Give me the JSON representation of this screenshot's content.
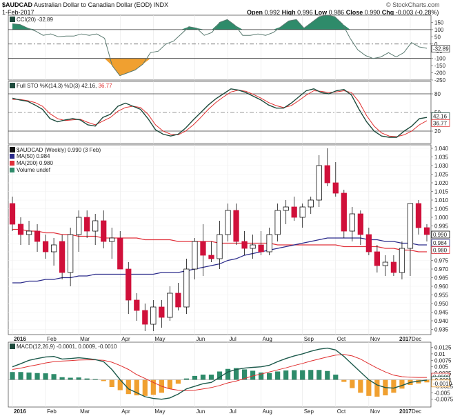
{
  "header": {
    "symbol": "$AUDCAD",
    "description": "Australian Dollar to Canadian Dollar (EOD)",
    "exchange": "INDX",
    "date": "1-Feb-2017",
    "open_label": "Open",
    "open": "0.992",
    "high_label": "High",
    "high": "0.996",
    "low_label": "Low",
    "low": "0.986",
    "close_label": "Close",
    "close": "0.990",
    "chg_label": "Chg",
    "chg": "-0.003 (-0.28%)",
    "watermark": "© StockCharts.com"
  },
  "months": [
    "2016",
    "Feb",
    "Mar",
    "Apr",
    "May",
    "Jun",
    "Jul",
    "Aug",
    "Sep",
    "Oct",
    "Nov",
    "Dec",
    "2017"
  ],
  "colors": {
    "up": "#ffffff",
    "down": "#d0103a",
    "ma50": "#2a2a8a",
    "ma200": "#e0303a",
    "cci_pos": "#2e8b6a",
    "cci_neg": "#f0a030",
    "sto_k": "#1d4a3c",
    "sto_d": "#e03030",
    "macd_line": "#1d5a4c",
    "signal_line": "#e03030",
    "hist_pos": "#2e8b6a",
    "hist_neg": "#f0a030"
  },
  "chart_data": [
    {
      "type": "line",
      "title": "CCI(20) -32.89",
      "series": [
        {
          "name": "CCI(20)",
          "values": [
            140,
            135,
            110,
            90,
            60,
            70,
            50,
            55,
            55,
            70,
            60,
            70,
            40,
            -150,
            -220,
            -200,
            -180,
            -140,
            -60,
            -50,
            0,
            20,
            70,
            120,
            110,
            60,
            80,
            150,
            170,
            130,
            60,
            60,
            70,
            60,
            80,
            120,
            160,
            170,
            110,
            150,
            190,
            200,
            190,
            140,
            40,
            -40,
            -80,
            -100,
            -90,
            -60,
            -90,
            -60,
            10,
            -20,
            -30
          ]
        }
      ],
      "ylim": [
        -250,
        200
      ],
      "yticks": [
        -250,
        -200,
        -150,
        -100,
        -50,
        0,
        50,
        100,
        150
      ],
      "current_label": "-32.89"
    },
    {
      "type": "line",
      "title": "Full STO %K(14,3) %D(3) 42.16, 36.77",
      "series": [
        {
          "name": "%K(14,3)",
          "values": [
            73,
            70,
            68,
            62,
            55,
            40,
            35,
            38,
            40,
            38,
            30,
            28,
            42,
            47,
            60,
            65,
            60,
            55,
            40,
            22,
            15,
            12,
            15,
            25,
            38,
            50,
            62,
            72,
            80,
            88,
            86,
            82,
            76,
            70,
            62,
            57,
            57,
            65,
            75,
            85,
            88,
            82,
            80,
            85,
            87,
            78,
            55,
            35,
            20,
            12,
            10,
            10,
            20,
            28,
            40,
            42
          ]
        },
        {
          "name": "%D(3)",
          "values": [
            71,
            71,
            69,
            66,
            60,
            48,
            40,
            37,
            38,
            39,
            34,
            30,
            36,
            42,
            52,
            58,
            60,
            58,
            47,
            30,
            20,
            15,
            14,
            20,
            30,
            42,
            55,
            66,
            75,
            83,
            86,
            84,
            79,
            73,
            66,
            61,
            58,
            61,
            69,
            78,
            85,
            84,
            82,
            83,
            85,
            82,
            67,
            45,
            28,
            17,
            12,
            11,
            14,
            20,
            30,
            36.77
          ]
        }
      ],
      "ylim": [
        0,
        100
      ],
      "yticks": [
        20,
        50,
        80
      ],
      "current_labels": [
        "42.16",
        "36.77"
      ]
    },
    {
      "type": "candlestick",
      "title": "$AUDCAD (Weekly) 0.990 (3 Feb)",
      "legend": [
        {
          "label": "MA(50) 0.984"
        },
        {
          "label": "MA(200) 0.980"
        },
        {
          "label": "Volume undef"
        }
      ],
      "x": [
        "2016",
        "Feb",
        "Mar",
        "Apr",
        "May",
        "Jun",
        "Jul",
        "Aug",
        "Sep",
        "Oct",
        "Nov",
        "Dec",
        "2017"
      ],
      "ohlc": [
        [
          1.008,
          1.012,
          0.992,
          0.996
        ],
        [
          0.996,
          1.0,
          0.984,
          0.99
        ],
        [
          0.99,
          0.998,
          0.984,
          0.992
        ],
        [
          0.992,
          0.996,
          0.98,
          0.986
        ],
        [
          0.986,
          0.99,
          0.976,
          0.98
        ],
        [
          0.98,
          0.988,
          0.972,
          0.984
        ],
        [
          0.986,
          0.99,
          0.964,
          0.968
        ],
        [
          0.968,
          0.994,
          0.96,
          0.99
        ],
        [
          0.99,
          1.004,
          0.98,
          1.0
        ],
        [
          1.0,
          1.004,
          0.988,
          0.992
        ],
        [
          0.992,
          1.002,
          0.984,
          0.998
        ],
        [
          0.998,
          1.004,
          0.982,
          0.986
        ],
        [
          0.986,
          0.994,
          0.976,
          0.988
        ],
        [
          0.988,
          0.992,
          0.97,
          0.97
        ],
        [
          0.97,
          0.974,
          0.944,
          0.952
        ],
        [
          0.952,
          0.956,
          0.94,
          0.946
        ],
        [
          0.946,
          0.95,
          0.934,
          0.938
        ],
        [
          0.938,
          0.952,
          0.934,
          0.948
        ],
        [
          0.948,
          0.952,
          0.936,
          0.942
        ],
        [
          0.942,
          0.96,
          0.94,
          0.956
        ],
        [
          0.956,
          0.962,
          0.946,
          0.948
        ],
        [
          0.948,
          0.976,
          0.944,
          0.97
        ],
        [
          0.97,
          0.988,
          0.964,
          0.986
        ],
        [
          0.986,
          0.996,
          0.966,
          0.978
        ],
        [
          0.978,
          0.986,
          0.974,
          0.976
        ],
        [
          0.976,
          0.998,
          0.97,
          0.99
        ],
        [
          0.99,
          1.008,
          0.986,
          1.004
        ],
        [
          1.004,
          1.008,
          0.984,
          0.986
        ],
        [
          0.986,
          0.992,
          0.978,
          0.982
        ],
        [
          0.982,
          0.99,
          0.976,
          0.984
        ],
        [
          0.984,
          0.992,
          0.978,
          0.98
        ],
        [
          0.98,
          0.994,
          0.978,
          0.99
        ],
        [
          0.99,
          1.008,
          0.986,
          1.004
        ],
        [
          1.004,
          1.01,
          0.996,
          1.006
        ],
        [
          1.006,
          1.012,
          0.998,
          1.0
        ],
        [
          1.0,
          1.008,
          0.994,
          1.006
        ],
        [
          1.006,
          1.012,
          1.002,
          1.01
        ],
        [
          1.01,
          1.036,
          1.006,
          1.03
        ],
        [
          1.03,
          1.04,
          1.018,
          1.02
        ],
        [
          1.02,
          1.032,
          1.012,
          1.014
        ],
        [
          1.014,
          1.016,
          0.988,
          0.992
        ],
        [
          0.992,
          1.006,
          0.986,
          1.002
        ],
        [
          1.002,
          1.004,
          0.984,
          0.99
        ],
        [
          0.99,
          0.994,
          0.978,
          0.98
        ],
        [
          0.98,
          0.984,
          0.968,
          0.972
        ],
        [
          0.972,
          0.978,
          0.966,
          0.974
        ],
        [
          0.974,
          0.978,
          0.966,
          0.968
        ],
        [
          0.968,
          0.986,
          0.964,
          0.982
        ],
        [
          0.982,
          1.008,
          0.966,
          1.008
        ],
        [
          1.008,
          1.01,
          0.99,
          0.994
        ],
        [
          0.994,
          0.996,
          0.986,
          0.99
        ]
      ],
      "ma50": [
        0.962,
        0.962,
        0.963,
        0.963,
        0.964,
        0.964,
        0.965,
        0.965,
        0.966,
        0.966,
        0.967,
        0.967,
        0.967,
        0.967,
        0.967,
        0.967,
        0.967,
        0.967,
        0.968,
        0.968,
        0.968,
        0.969,
        0.97,
        0.971,
        0.972,
        0.973,
        0.975,
        0.976,
        0.978,
        0.979,
        0.98,
        0.981,
        0.982,
        0.983,
        0.984,
        0.985,
        0.986,
        0.987,
        0.988,
        0.988,
        0.988,
        0.988,
        0.988,
        0.987,
        0.987,
        0.986,
        0.986,
        0.985,
        0.985,
        0.984,
        0.984
      ],
      "ma200": [
        0.993,
        0.993,
        0.992,
        0.992,
        0.991,
        0.991,
        0.99,
        0.99,
        0.989,
        0.989,
        0.989,
        0.988,
        0.988,
        0.988,
        0.988,
        0.988,
        0.987,
        0.987,
        0.987,
        0.987,
        0.986,
        0.986,
        0.986,
        0.986,
        0.986,
        0.985,
        0.985,
        0.985,
        0.985,
        0.985,
        0.985,
        0.985,
        0.984,
        0.984,
        0.984,
        0.984,
        0.984,
        0.984,
        0.984,
        0.984,
        0.983,
        0.983,
        0.983,
        0.983,
        0.983,
        0.982,
        0.982,
        0.981,
        0.981,
        0.98,
        0.98
      ],
      "ylim": [
        0.932,
        1.042
      ],
      "yticks": [
        0.935,
        0.94,
        0.945,
        0.95,
        0.955,
        0.96,
        0.965,
        0.97,
        0.975,
        0.98,
        0.985,
        0.99,
        0.995,
        1.0,
        1.005,
        1.01,
        1.015,
        1.02,
        1.025,
        1.03,
        1.035,
        1.04
      ],
      "current_labels": [
        "0.990",
        "0.984",
        "0.980"
      ]
    },
    {
      "type": "line",
      "title": "MACD(12,26,9) -0.0001, 0.0009, -0.0010",
      "series": [
        {
          "name": "MACD",
          "values": [
            0.005,
            0.0062,
            0.0075,
            0.0082,
            0.0088,
            0.009,
            0.008,
            0.0082,
            0.0085,
            0.0082,
            0.0078,
            0.007,
            0.004,
            0.0,
            -0.0035,
            -0.005,
            -0.0065,
            -0.0072,
            -0.0075,
            -0.007,
            -0.0055,
            -0.0035,
            -0.0025,
            -0.0015,
            -0.001,
            0.001,
            0.003,
            0.004,
            0.0045,
            0.0048,
            0.005,
            0.0056,
            0.007,
            0.0082,
            0.0092,
            0.01,
            0.011,
            0.0118,
            0.0122,
            0.0115,
            0.009,
            0.006,
            0.003,
            0.0,
            -0.002,
            -0.003,
            -0.0032,
            -0.0022,
            -0.001,
            -0.0005,
            -0.0001
          ]
        },
        {
          "name": "Signal",
          "values": [
            0.004,
            0.0045,
            0.0052,
            0.0058,
            0.0065,
            0.007,
            0.0072,
            0.0074,
            0.0076,
            0.0077,
            0.0077,
            0.0075,
            0.0068,
            0.0055,
            0.004,
            0.002,
            0.0005,
            -0.001,
            -0.0025,
            -0.0035,
            -0.004,
            -0.0042,
            -0.004,
            -0.0035,
            -0.003,
            -0.0022,
            -0.0012,
            -0.0005,
            0.0005,
            0.0015,
            0.0022,
            0.003,
            0.0038,
            0.0046,
            0.0055,
            0.0063,
            0.0072,
            0.008,
            0.0088,
            0.0095,
            0.0098,
            0.0092,
            0.008,
            0.0062,
            0.0045,
            0.003,
            0.0018,
            0.0012,
            0.001,
            0.0009,
            0.0009
          ]
        },
        {
          "name": "Histogram",
          "values": [
            0.003,
            0.003,
            0.0028,
            0.0026,
            0.0025,
            0.0022,
            0.001,
            0.0008,
            0.0009,
            0.0005,
            0.0003,
            -0.0005,
            -0.0028,
            -0.004,
            -0.0055,
            -0.006,
            -0.0062,
            -0.0058,
            -0.005,
            -0.0035,
            -0.0015,
            0.0005,
            0.0015,
            0.002,
            0.002,
            0.0032,
            0.0042,
            0.0045,
            0.004,
            0.0035,
            0.0028,
            0.0026,
            0.0032,
            0.0036,
            0.0037,
            0.0037,
            0.0038,
            0.0038,
            0.0034,
            0.002,
            -0.0008,
            -0.0032,
            -0.005,
            -0.0062,
            -0.0065,
            -0.006,
            -0.005,
            -0.0034,
            -0.002,
            -0.0014,
            -0.001
          ]
        }
      ],
      "ylim": [
        -0.0105,
        0.0145
      ],
      "yticks": [
        -0.0075,
        -0.005,
        -0.0025,
        0.0,
        0.0025,
        0.005,
        0.0075,
        0.01,
        0.0125
      ],
      "current_labels": [
        "0.0009",
        "-0.0001",
        "-0.0010"
      ]
    }
  ]
}
